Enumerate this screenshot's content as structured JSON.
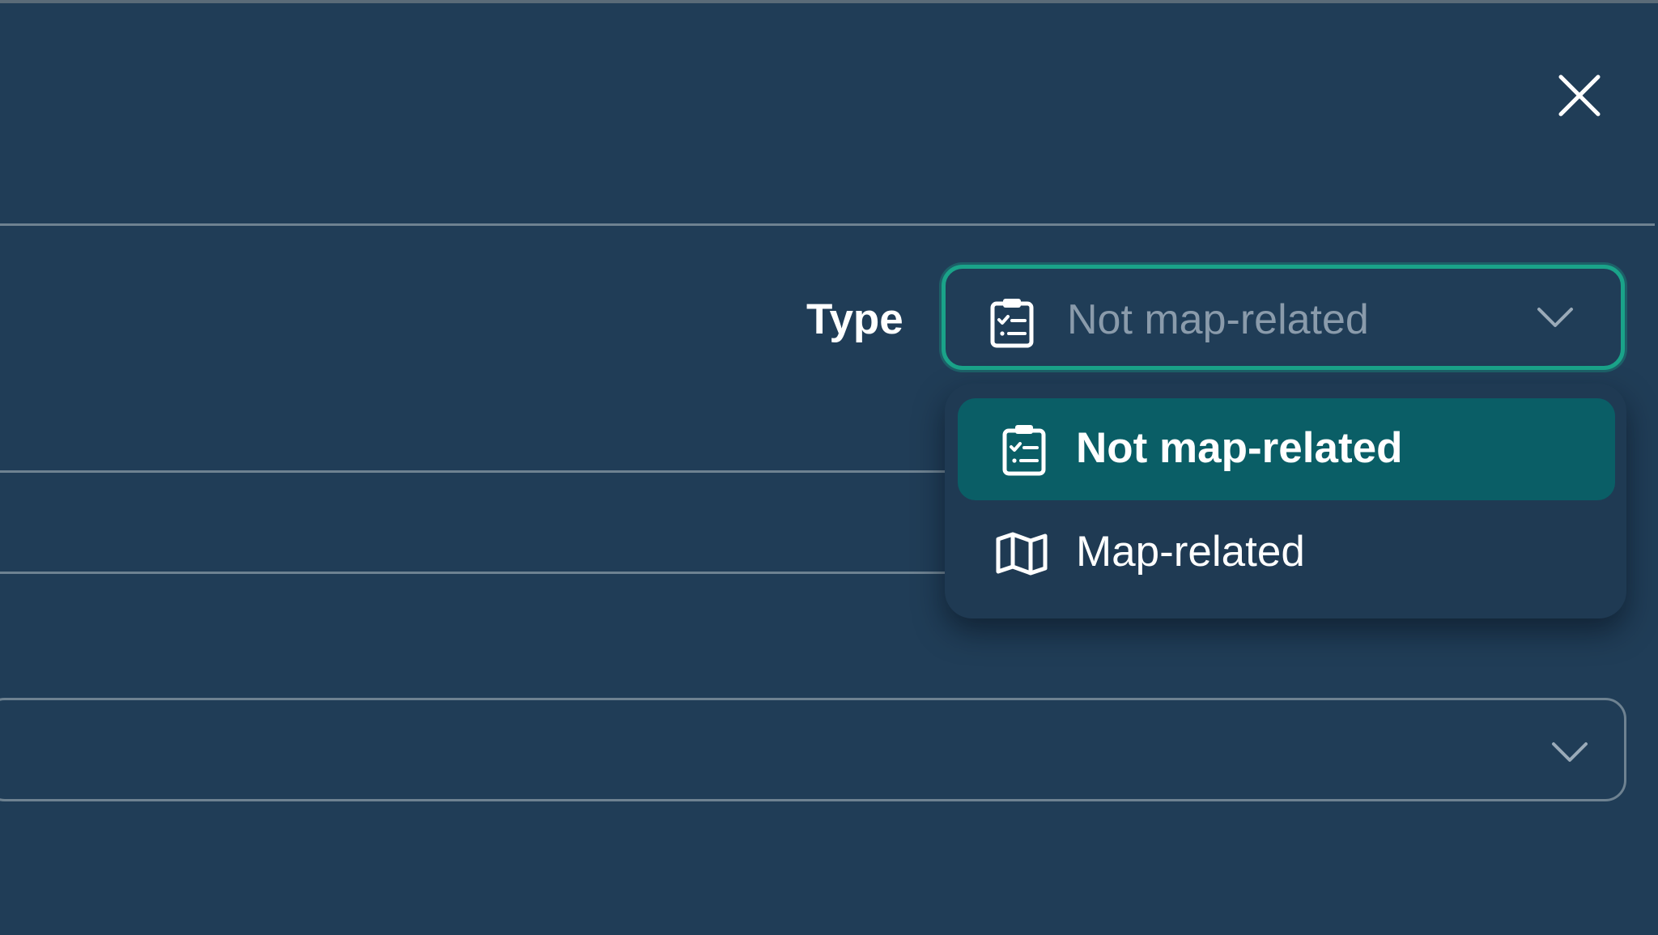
{
  "header": {
    "close_icon": "close-icon"
  },
  "type_field": {
    "label": "Type",
    "selected_value": "Not map-related",
    "icon": "clipboard-checklist-icon"
  },
  "dropdown": {
    "options": [
      {
        "label": "Not map-related",
        "icon": "clipboard-checklist-icon",
        "selected": true
      },
      {
        "label": "Map-related",
        "icon": "map-icon",
        "selected": false
      }
    ]
  },
  "colors": {
    "background": "#203d57",
    "accent": "#1aa389",
    "selected_option": "#0a5e66",
    "text": "#ffffff",
    "placeholder": "#8a9bab"
  }
}
